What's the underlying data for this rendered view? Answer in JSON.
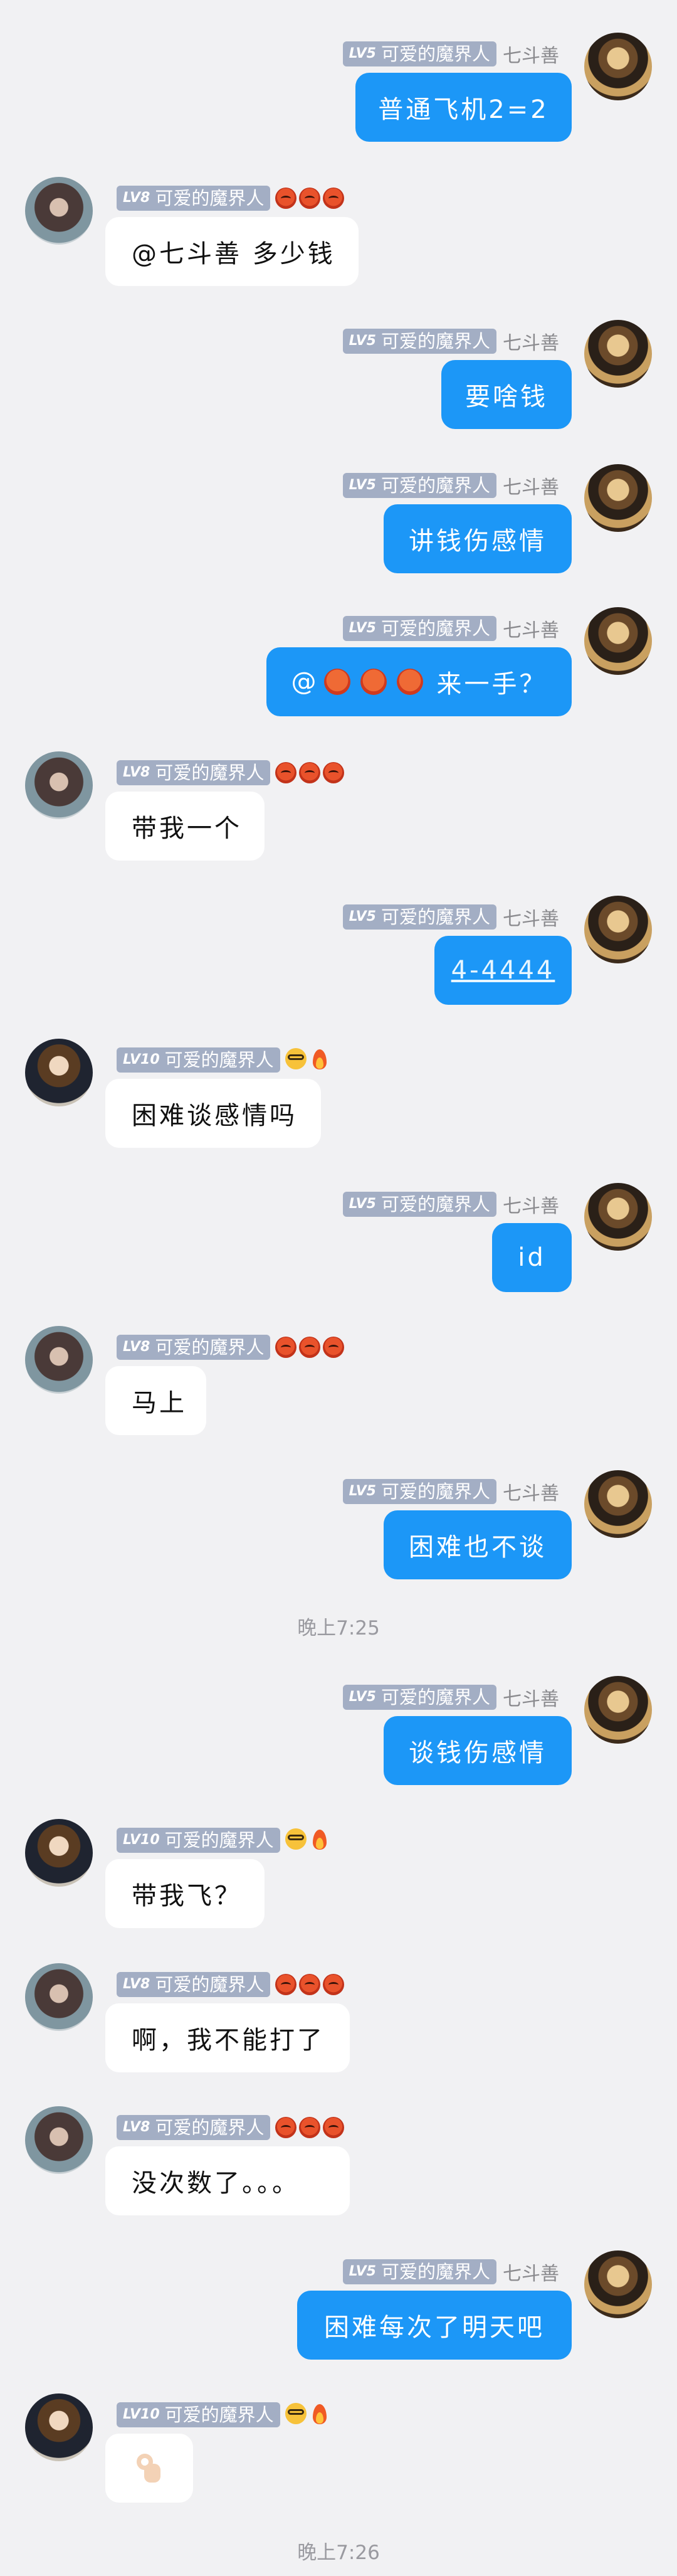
{
  "users": {
    "me": {
      "level": "LV5",
      "nickname": "可爱的魔界人",
      "sender": "七斗善"
    },
    "lv8": {
      "level": "LV8",
      "nickname": "可爱的魔界人"
    },
    "lv10": {
      "level": "LV10",
      "nickname": "可爱的魔界人"
    }
  },
  "colors": {
    "outgoing_bubble": "#1c97f7",
    "incoming_bubble": "#ffffff",
    "badge": "#a3aec4",
    "background": "#f1f1f3"
  },
  "messages": [
    {
      "text": "普通飞机2=2"
    },
    {
      "text": "@七斗善 多少钱"
    },
    {
      "text": "要啥钱"
    },
    {
      "text": "讲钱伤感情"
    },
    {
      "prefix": "@",
      "text": "来一手？",
      "emoji": "hot-face-emoji"
    },
    {
      "text": "带我一个"
    },
    {
      "text": "4-4444"
    },
    {
      "text": "困难谈感情吗"
    },
    {
      "text": "id"
    },
    {
      "text": "马上"
    },
    {
      "text": "困难也不谈"
    },
    {
      "text": "谈钱伤感情"
    },
    {
      "text": "带我飞？"
    },
    {
      "text": "啊，我不能打了"
    },
    {
      "text": "没次数了。。。"
    },
    {
      "text": "困难每次了明天吧"
    },
    {
      "emoji": "ok-hand-emoji"
    }
  ],
  "timestamps": [
    "晚上7:25",
    "晚上7:26"
  ],
  "badge_emojis": {
    "lv8": [
      "hot-face-emoji",
      "hot-face-emoji",
      "hot-face-emoji"
    ],
    "lv10": [
      "nerd-face-emoji",
      "fire-emoji"
    ]
  }
}
